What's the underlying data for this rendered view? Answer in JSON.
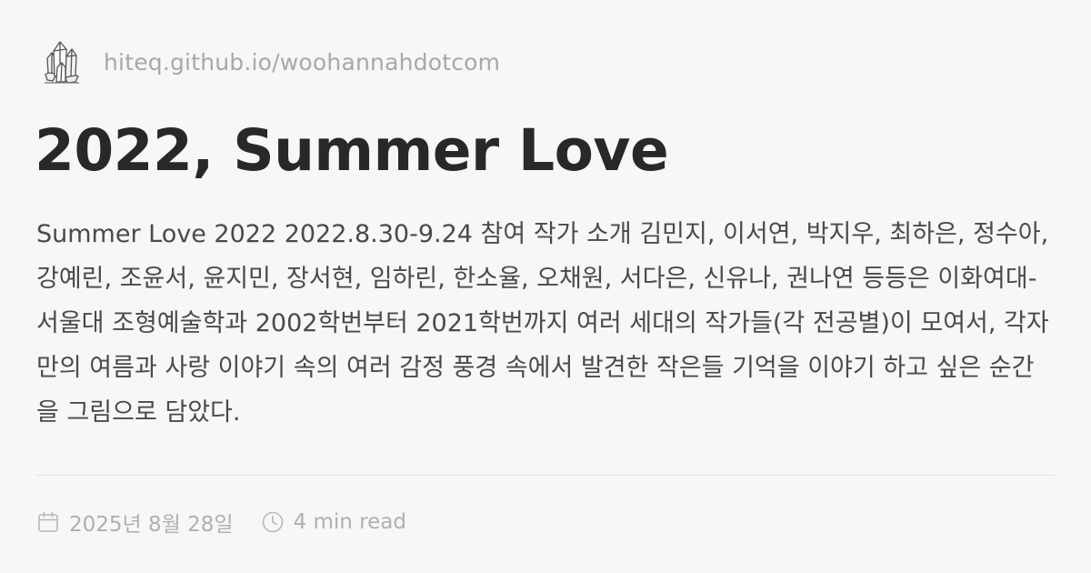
{
  "site": {
    "url": "hiteq.github.io/woohannahdotcom",
    "logo_icon": "crystal-cluster-icon"
  },
  "post": {
    "title": "2022, Summer Love",
    "summary": "Summer Love 2022 2022.8.30-9.24 참여 작가 소개 김민지, 이서연, 박지우, 최하은, 정수아, 강예린, 조윤서, 윤지민, 장서현, 임하린, 한소율, 오채원, 서다은, 신유나, 권나연 등등은 이화여대-서울대 조형예술학과 2002학번부터 2021학번까지 여러 세대의 작가들(각 전공별)이 모여서, 각자만의 여름과 사랑 이야기 속의 여러 감정 풍경 속에서 발견한 작은들 기억을 이야기 하고 싶은 순간을 그림으로 담았다."
  },
  "meta": {
    "date": "2025년 8월 28일",
    "date_icon": "calendar-icon",
    "read_time": "4 min read",
    "read_icon": "clock-icon"
  }
}
